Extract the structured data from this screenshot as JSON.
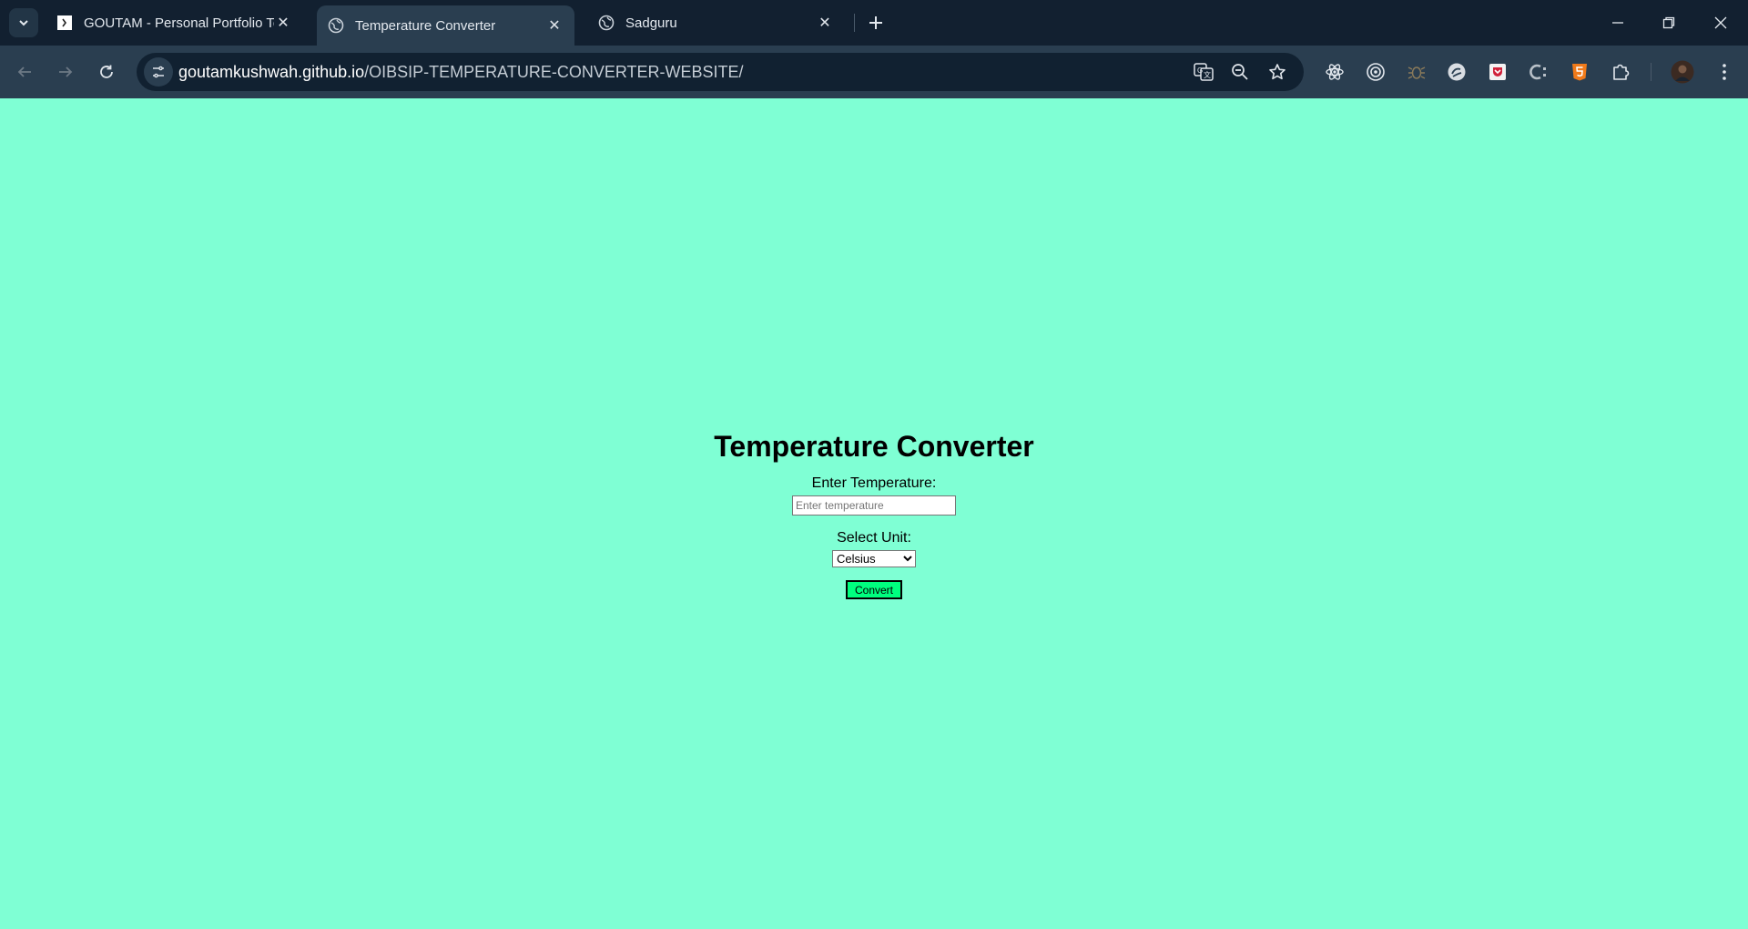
{
  "browser": {
    "tabs": [
      {
        "title": "GOUTAM - Personal Portfolio Te",
        "favicon": "portfolio-favicon"
      },
      {
        "title": "Temperature Converter",
        "favicon": "globe-icon"
      },
      {
        "title": "Sadguru",
        "favicon": "globe-icon"
      }
    ],
    "url_host": "goutamkushwah.github.io",
    "url_path": "/OIBSIP-TEMPERATURE-CONVERTER-WEBSITE/"
  },
  "page": {
    "heading": "Temperature Converter",
    "temp_label": "Enter Temperature:",
    "temp_placeholder": "Enter temperature",
    "temp_value": "",
    "unit_label": "Select Unit:",
    "unit_selected": "Celsius",
    "convert_label": "Convert"
  },
  "colors": {
    "page_background": "#7fffd4",
    "button_background": "#00ff7f",
    "browser_frame": "#122030"
  }
}
